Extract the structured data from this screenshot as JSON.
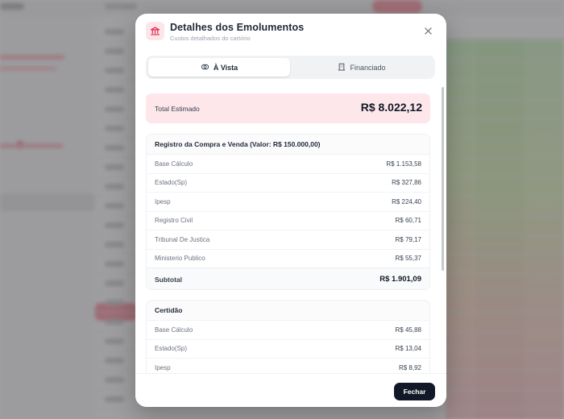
{
  "modal": {
    "title": "Detalhes dos Emolumentos",
    "subtitle": "Custos detalhados do cartório",
    "header_icon": "bank-icon",
    "close_icon": "close-icon"
  },
  "tabs": [
    {
      "label": "À Vista",
      "icon": "cash-icon",
      "active": true
    },
    {
      "label": "Financiado",
      "icon": "building-icon",
      "active": false
    }
  ],
  "total": {
    "label": "Total Estimado",
    "value": "R$ 8.022,12"
  },
  "sections": [
    {
      "title": "Registro da Compra e Venda (Valor: R$ 150.000,00)",
      "items": [
        {
          "label": "Base Cálculo",
          "value": "R$ 1.153,58"
        },
        {
          "label": "Estado(Sp)",
          "value": "R$ 327,86"
        },
        {
          "label": "Ipesp",
          "value": "R$ 224,40"
        },
        {
          "label": "Registro Civil",
          "value": "R$ 60,71"
        },
        {
          "label": "Tribunal De Justica",
          "value": "R$ 79,17"
        },
        {
          "label": "Ministerio Publico",
          "value": "R$ 55,37"
        }
      ],
      "subtotal": {
        "label": "Subtotal",
        "value": "R$ 1.901,09"
      }
    },
    {
      "title": "Certidão",
      "items": [
        {
          "label": "Base Cálculo",
          "value": "R$ 45,88"
        },
        {
          "label": "Estado(Sp)",
          "value": "R$ 13,04"
        },
        {
          "label": "Ipesp",
          "value": "R$ 8,92"
        }
      ]
    }
  ],
  "footer": {
    "close_label": "Fechar"
  },
  "colors": {
    "accent_pink": "#fde7ea",
    "icon_red": "#e11d48",
    "button_dark": "#111827"
  }
}
